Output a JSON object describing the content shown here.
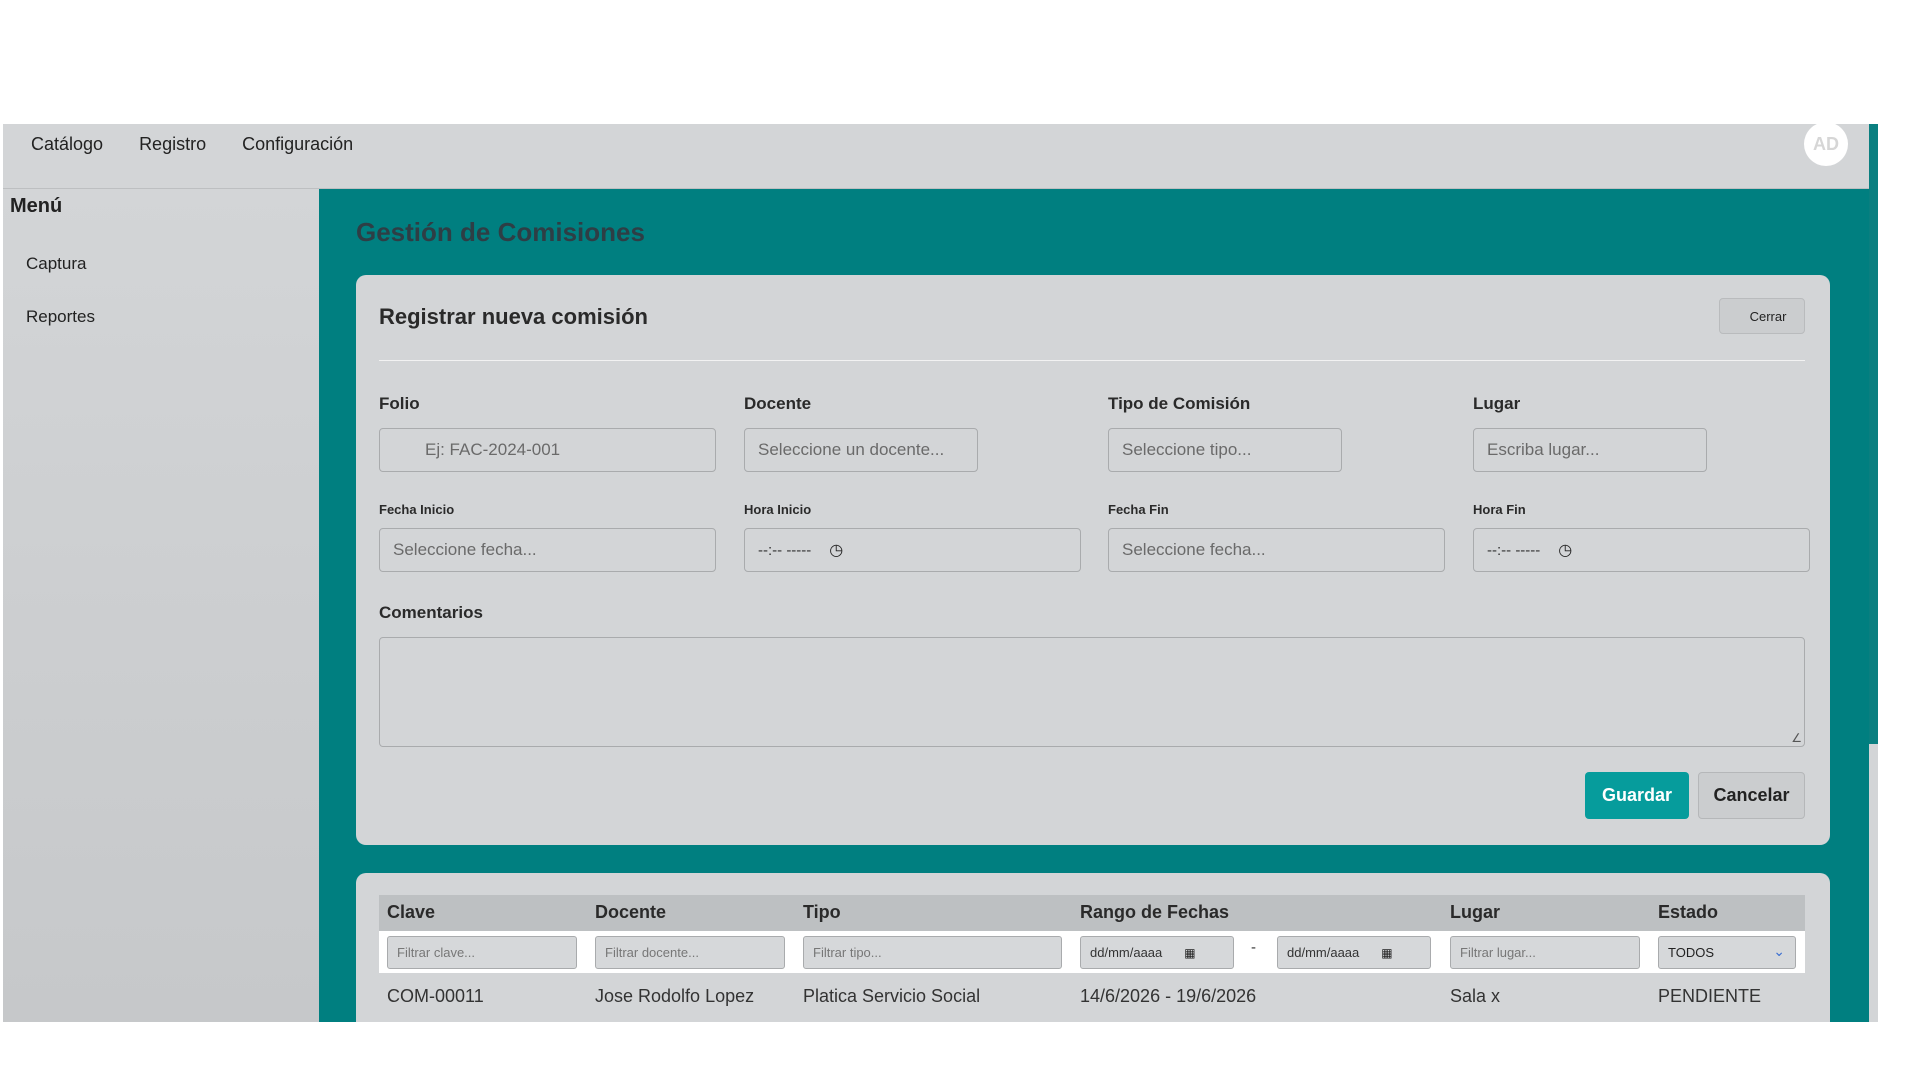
{
  "topnav": {
    "items": [
      "Catálogo",
      "Registro",
      "Configuración"
    ]
  },
  "user": {
    "initials": "AD"
  },
  "sidebar": {
    "title": "Menú",
    "items": [
      "Captura",
      "Reportes"
    ]
  },
  "page": {
    "title": "Gestión de Comisiones"
  },
  "form": {
    "title": "Registrar nueva comisión",
    "close_label": "Cerrar",
    "folio": {
      "label": "Folio",
      "placeholder": "Ej: FAC-2024-001"
    },
    "docente": {
      "label": "Docente",
      "placeholder": "Seleccione un docente..."
    },
    "tipo": {
      "label": "Tipo de Comisión",
      "placeholder": "Seleccione tipo..."
    },
    "lugar": {
      "label": "Lugar",
      "placeholder": "Escriba lugar..."
    },
    "fecha_inicio": {
      "label": "Fecha Inicio",
      "placeholder": "Seleccione fecha..."
    },
    "hora_inicio": {
      "label": "Hora Inicio",
      "value": "--:-- -----"
    },
    "fecha_fin": {
      "label": "Fecha Fin",
      "placeholder": "Seleccione fecha..."
    },
    "hora_fin": {
      "label": "Hora Fin",
      "value": "--:-- -----"
    },
    "comentarios": {
      "label": "Comentarios"
    },
    "save_label": "Guardar",
    "cancel_label": "Cancelar"
  },
  "table": {
    "headers": [
      "Clave",
      "Docente",
      "Tipo",
      "Rango de Fechas",
      "Lugar",
      "Estado"
    ],
    "filters": {
      "clave": "Filtrar clave...",
      "docente": "Filtrar docente...",
      "tipo": "Filtrar tipo...",
      "fecha_desde": "dd/mm/aaaa",
      "separator": "-",
      "fecha_hasta": "dd/mm/aaaa",
      "lugar": "Filtrar lugar...",
      "estado": "TODOS"
    },
    "rows": [
      {
        "clave": "COM-00011",
        "docente": "Jose Rodolfo Lopez",
        "tipo": "Platica Servicio Social",
        "rango": "14/6/2026 - 19/6/2026",
        "lugar": "Sala x",
        "estado": "PENDIENTE"
      }
    ]
  },
  "colors": {
    "accent": "#007f80",
    "primary_button": "#069c9c",
    "surface": "#d3d5d7"
  }
}
